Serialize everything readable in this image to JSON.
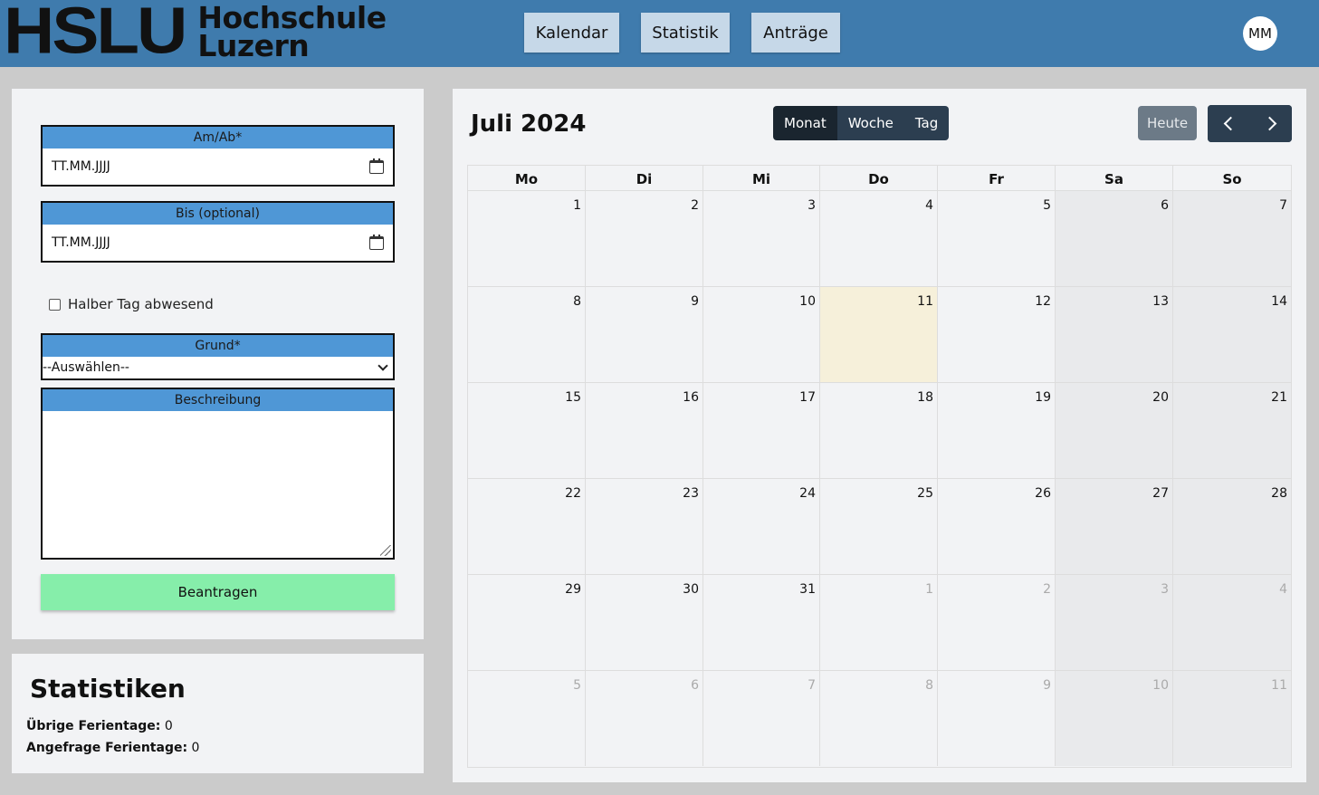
{
  "header": {
    "logo_main": "HSLU",
    "logo_sub_line1": "Hochschule",
    "logo_sub_line2": "Luzern",
    "nav": [
      "Kalendar",
      "Statistik",
      "Anträge"
    ],
    "avatar_initials": "MM"
  },
  "form": {
    "from_label": "Am/Ab*",
    "from_placeholder": "TT.MM.JJJJ",
    "to_label": "Bis (optional)",
    "to_placeholder": "TT.MM.JJJJ",
    "half_day_label": "Halber Tag abwesend",
    "half_day_checked": false,
    "reason_label": "Grund*",
    "reason_selected": "--Auswählen--",
    "description_label": "Beschreibung",
    "description_value": "",
    "submit_label": "Beantragen"
  },
  "stats": {
    "title": "Statistiken",
    "remaining_label": "Übrige Ferientage:",
    "remaining_value": "0",
    "requested_label": "Angefrage Ferientage:",
    "requested_value": "0"
  },
  "calendar": {
    "title": "Juli 2024",
    "views": [
      "Monat",
      "Woche",
      "Tag"
    ],
    "active_view": "Monat",
    "today_label": "Heute",
    "weekdays": [
      "Mo",
      "Di",
      "Mi",
      "Do",
      "Fr",
      "Sa",
      "So"
    ],
    "days": [
      {
        "d": "1",
        "m": "cur"
      },
      {
        "d": "2",
        "m": "cur"
      },
      {
        "d": "3",
        "m": "cur"
      },
      {
        "d": "4",
        "m": "cur"
      },
      {
        "d": "5",
        "m": "cur"
      },
      {
        "d": "6",
        "m": "cur"
      },
      {
        "d": "7",
        "m": "cur"
      },
      {
        "d": "8",
        "m": "cur"
      },
      {
        "d": "9",
        "m": "cur"
      },
      {
        "d": "10",
        "m": "cur"
      },
      {
        "d": "11",
        "m": "today"
      },
      {
        "d": "12",
        "m": "cur"
      },
      {
        "d": "13",
        "m": "cur"
      },
      {
        "d": "14",
        "m": "cur"
      },
      {
        "d": "15",
        "m": "cur"
      },
      {
        "d": "16",
        "m": "cur"
      },
      {
        "d": "17",
        "m": "cur"
      },
      {
        "d": "18",
        "m": "cur"
      },
      {
        "d": "19",
        "m": "cur"
      },
      {
        "d": "20",
        "m": "cur"
      },
      {
        "d": "21",
        "m": "cur"
      },
      {
        "d": "22",
        "m": "cur"
      },
      {
        "d": "23",
        "m": "cur"
      },
      {
        "d": "24",
        "m": "cur"
      },
      {
        "d": "25",
        "m": "cur"
      },
      {
        "d": "26",
        "m": "cur"
      },
      {
        "d": "27",
        "m": "cur"
      },
      {
        "d": "28",
        "m": "cur"
      },
      {
        "d": "29",
        "m": "cur"
      },
      {
        "d": "30",
        "m": "cur"
      },
      {
        "d": "31",
        "m": "cur"
      },
      {
        "d": "1",
        "m": "other"
      },
      {
        "d": "2",
        "m": "other"
      },
      {
        "d": "3",
        "m": "other"
      },
      {
        "d": "4",
        "m": "other"
      },
      {
        "d": "5",
        "m": "other"
      },
      {
        "d": "6",
        "m": "other"
      },
      {
        "d": "7",
        "m": "other"
      },
      {
        "d": "8",
        "m": "other"
      },
      {
        "d": "9",
        "m": "other"
      },
      {
        "d": "10",
        "m": "other"
      },
      {
        "d": "11",
        "m": "other"
      }
    ]
  },
  "icons": {
    "date_picker": "calendar-icon",
    "prev": "chevron-left-icon",
    "next": "chevron-right-icon",
    "select": "chevron-down-icon"
  },
  "colors": {
    "header_bg": "#3f7bad",
    "nav_button_bg": "#c6d8e8",
    "field_label_bg": "#4f97d6",
    "submit_bg": "#86eeaa",
    "calendar_button_bg": "#2c3e50",
    "today_cell_bg": "#f6f0da",
    "weekend_cell_bg": "#e9eaec"
  }
}
